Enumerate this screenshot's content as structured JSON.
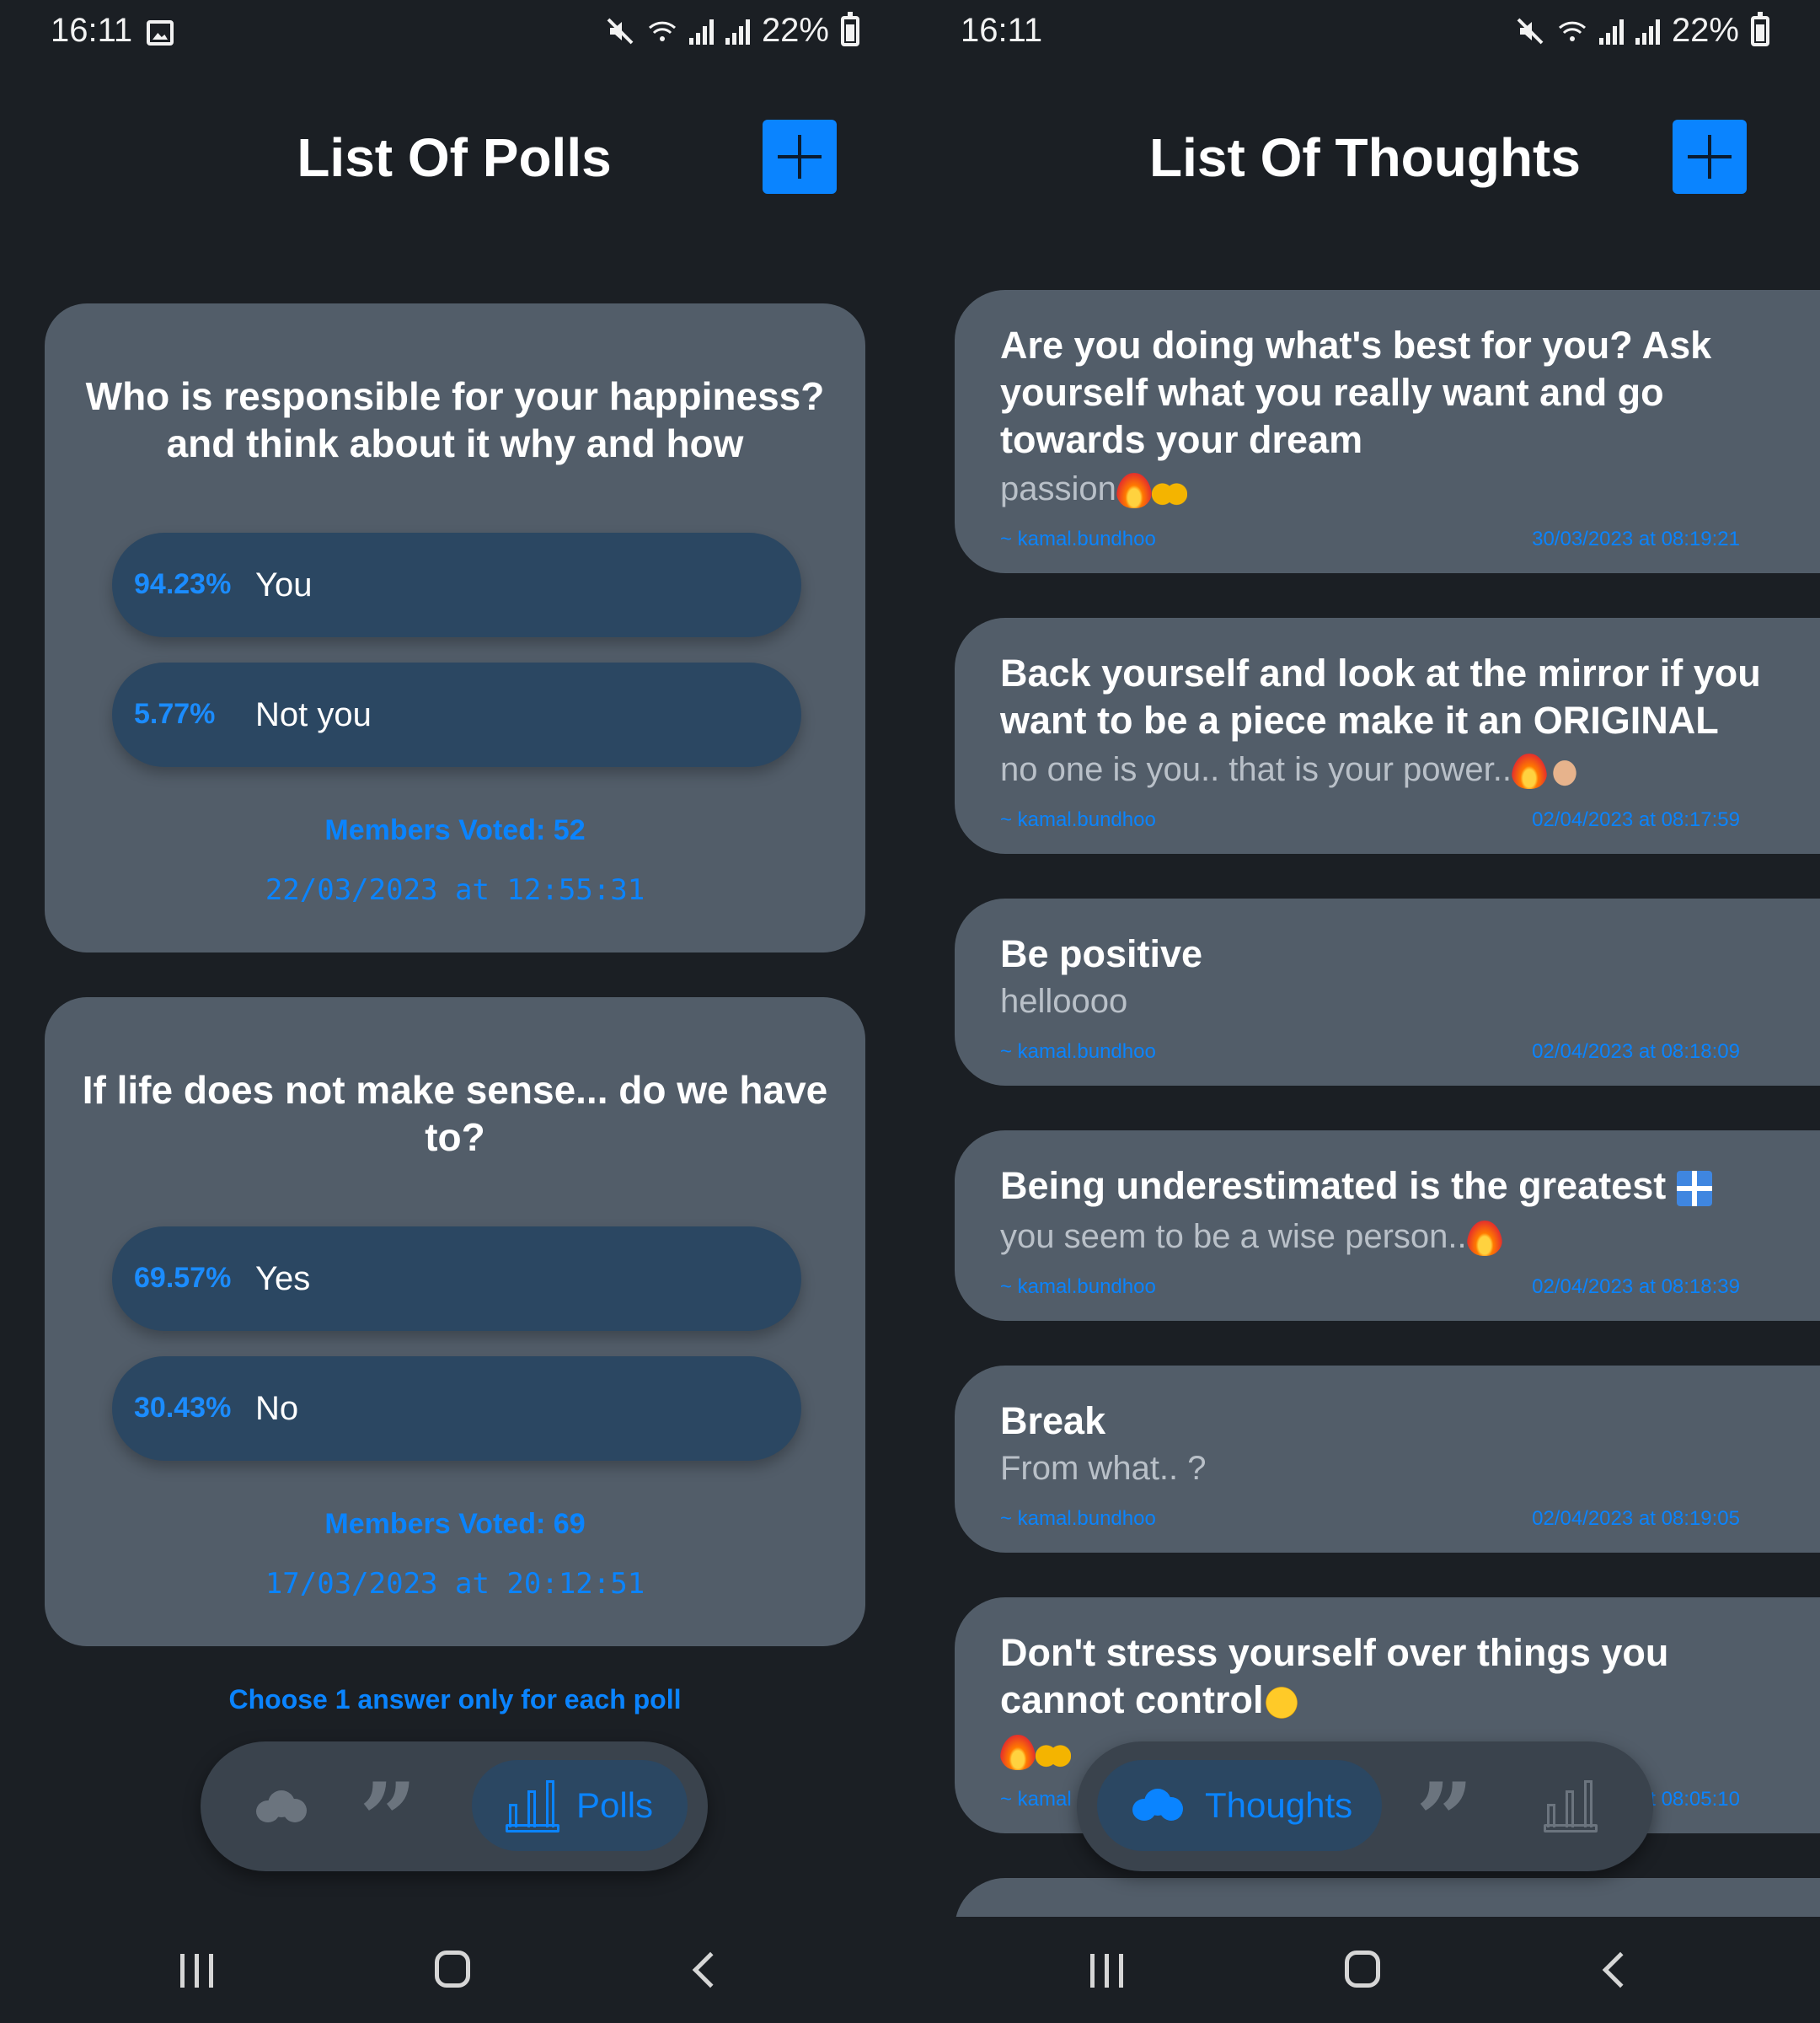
{
  "status_bar": {
    "left_time": "16:11",
    "right_time": "16:11",
    "battery": "22%"
  },
  "polls_screen": {
    "title": "List Of Polls",
    "polls": [
      {
        "question": "Who is responsible for your happiness? and think about it why and how",
        "options": [
          {
            "percent": "94.23%",
            "label": "You"
          },
          {
            "percent": "5.77%",
            "label": "Not you"
          }
        ],
        "members_voted": "Members Voted: 52",
        "date": "22/03/2023 at 12:55:31"
      },
      {
        "question": "If life does not make sense... do we have to?",
        "options": [
          {
            "percent": "69.57%",
            "label": "Yes"
          },
          {
            "percent": "30.43%",
            "label": "No"
          }
        ],
        "members_voted": "Members Voted: 69",
        "date": "17/03/2023 at 20:12:51"
      }
    ],
    "hint": "Choose 1 answer only for each poll",
    "tabs": {
      "active_label": "Polls"
    }
  },
  "thoughts_screen": {
    "title": "List Of Thoughts",
    "thoughts": [
      {
        "title": "Are you doing what's best for you? Ask yourself what you really want and go towards your dream",
        "subtitle": "passion",
        "author": "~ kamal.bundhoo",
        "date": "30/03/2023 at 08:19:21"
      },
      {
        "title": "Back yourself and look at the mirror if you want to be a piece make it an ORIGINAL",
        "subtitle": "no one is you.. that is your power..",
        "author": "~ kamal.bundhoo",
        "date": "02/04/2023 at 08:17:59"
      },
      {
        "title": "Be positive",
        "subtitle": "helloooo",
        "author": "~ kamal.bundhoo",
        "date": "02/04/2023 at 08:18:09"
      },
      {
        "title": "Being underestimated is the greatest",
        "subtitle": "you seem to be a wise person..",
        "author": "~ kamal.bundhoo",
        "date": "02/04/2023 at 08:18:39"
      },
      {
        "title": "Break",
        "subtitle": "From what.. ?",
        "author": "~ kamal.bundhoo",
        "date": "02/04/2023 at 08:19:05"
      },
      {
        "title": "Don't stress yourself over things you cannot control",
        "subtitle": "",
        "author": "~ kamal",
        "date": "t 08:05:10"
      }
    ],
    "tabs": {
      "active_label": "Thoughts"
    }
  },
  "icons": {
    "add": "plus-icon",
    "thoughts_tab": "cloud-icon",
    "quotes_tab": "quote-icon",
    "polls_tab": "bar-chart-icon",
    "nav_recents": "recents-icon",
    "nav_home": "home-icon",
    "nav_back": "back-icon"
  },
  "colors": {
    "background": "#1b1f24",
    "card": "#525d69",
    "pill": "#2b4762",
    "accent": "#0a84ff"
  }
}
